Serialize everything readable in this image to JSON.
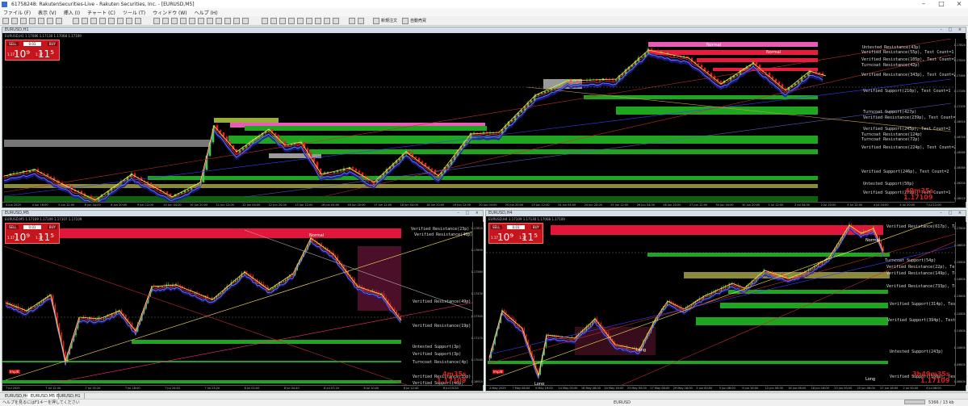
{
  "titlebar": {
    "title": "61758248: RakutenSecurities-Live - Rakuten Securities, Inc. - [EURUSD,M5]"
  },
  "menu": [
    "ファイル (F)",
    "表示 (V)",
    "挿入 (I)",
    "チャート (C)",
    "ツール (T)",
    "ウィンドウ (W)",
    "ヘルプ (H)"
  ],
  "toolbar": {
    "new_order": "新規注文",
    "auto_trade": "自動売買"
  },
  "panel": {
    "sell": "SELL",
    "buy": "BUY",
    "lot": "0.01",
    "prefix": "1.17",
    "sell_big": "10⁹",
    "buy_big": "11⁵"
  },
  "top": {
    "title": "EURUSD,H1",
    "header": "EURUSD,H1  1.17086 1.17130 1.17068 1.17109",
    "labels": [
      "Untested Resistance(43p)",
      "Verified Resistance(55p), Test Count=1",
      "Verified Resistance(105p), Test Count=1",
      "Turncoat Resistance(42p)",
      "Verified Resistance(343p), Test Count=2",
      "Verified Support(210p), Test Count=1",
      "Turncoat Support(427p)",
      "Verified Resistance(239p), Test Count=1",
      "Verified Support(245p), Test Count=2",
      "Turncoat Resistance(124p)",
      "Turncoat Resistance(72p)",
      "Verified Resistance(224p), Test Count=2",
      "Verified Support(246p), Test Count=2",
      "Untested Support(50p)",
      "Verified Support(279p), Test Count=1"
    ],
    "timer": "49m35s",
    "price": "1.17109",
    "markers": [
      "Normal",
      "Normal",
      "Normal"
    ],
    "prices": [
      "1.17820",
      "1.17640",
      "1.17460",
      "1.17280",
      "1.17100",
      "1.16920",
      "1.16740",
      "1.16560",
      "1.16380",
      "1.16200",
      "1.16020"
    ],
    "times": [
      "4 Jun 2025",
      "4 Jun 16:00",
      "5 Jun 12:00",
      "6 Jun 04:00",
      "6 Jun 20:00",
      "9 Jun 12:00",
      "10 Jun 04:00",
      "10 Jun 20:00",
      "11 Jun 12:00",
      "12 Jun 04:00",
      "12 Jun 20:00",
      "13 Jun 12:00",
      "16 Jun 04:00",
      "16 Jun 20:00",
      "17 Jun 12:00",
      "18 Jun 04:00",
      "18 Jun 20:00",
      "19 Jun 12:00",
      "20 Jun 04:00",
      "20 Jun 20:00",
      "23 Jun 12:00",
      "24 Jun 04:00",
      "24 Jun 20:00",
      "25 Jun 12:00",
      "26 Jun 04:00",
      "26 Jun 20:00",
      "27 Jun 12:00",
      "30 Jun 04:00",
      "30 Jun 20:00",
      "1 Jul 12:00",
      "2 Jul 04:00",
      "2 Jul 20:00",
      "3 Jul 12:00",
      "4 Jul 04:00",
      "4 Jul 20:00",
      "7 Jul 12:00"
    ]
  },
  "bl": {
    "title": "EURUSD,M5",
    "header": "EURUSD,M5  1.17109 1.17109 1.17107 1.17109",
    "labels": [
      "Verified Resistance(23p)",
      "Verified Resistance(40p)",
      "Verified Resistance(49p)",
      "Verified Resistance(19p)",
      "Untested Support(3p)",
      "Verified Support(3p)",
      "Turncoat Resistance(4p)",
      "Verified Resistance(35p)",
      "Verified Support(40p)"
    ],
    "timer": "4m35s",
    "price": "1.17109",
    "marker": "Normal",
    "badge": "Imp/8",
    "prices": [
      "1.17820",
      "1.17690",
      "1.17560",
      "1.17430",
      "1.17300",
      "1.17170",
      "1.17040",
      "1.16910"
    ],
    "times": [
      "7 Jul 2025",
      "7 Jul 12:40",
      "7 Jul 15:20",
      "7 Jul 18:00",
      "7 Jul 20:40",
      "7 Jul 23:20",
      "8 Jul 02:00",
      "8 Jul 04:40",
      "8 Jul 07:20",
      "8 Jul 10:00",
      "8 Jul 12:40",
      "8 Jul 15:20"
    ]
  },
  "br": {
    "title": "EURUSD,H4",
    "header": "EURUSD,H4  1.17109 1.17130 1.17068 1.17109",
    "labels": [
      "Verified Resistance(617p), Test Count=1",
      "Turncoat Support(54p)",
      "Verified Resistance(22p), Test Count=1",
      "Verified Resistance(149p), Test Count=1",
      "Verified Resistance(733p), Test Count=1",
      "Verified Support(314p), Test Count=1",
      "Verified Support(394p), Test Count=1",
      "Untested Support(243p)",
      "Verified Support(166p), Test Count=1"
    ],
    "timer": "3h49m35s",
    "price": "1.17109",
    "markers": [
      "Long",
      "Long",
      "Long",
      "Normal"
    ],
    "badge": "Imp/8",
    "prices": [
      "1.17800",
      "1.16800",
      "1.15800",
      "1.14800",
      "1.13800",
      "1.12800",
      "1.11800",
      "1.10800",
      "1.09800",
      "1.08800"
    ],
    "times": [
      "2 May 2025",
      "7 May 08:00",
      "9 May 16:00",
      "14 May 00:00",
      "16 May 08:00",
      "20 May 16:00",
      "23 May 00:00",
      "27 May 08:00",
      "29 May 16:00",
      "3 Jun 00:00",
      "5 Jun 08:00",
      "9 Jun 16:00",
      "12 Jun 00:00",
      "16 Jun 08:00",
      "18 Jun 16:00",
      "23 Jun 00:00",
      "25 Jun 08:00",
      "27 Jun 16:00",
      "2 Jul 00:00",
      "4 Jul 08:00"
    ]
  },
  "tabs": [
    "EURUSD,H4",
    "EURUSD,M5",
    "EURUSD,H1"
  ],
  "status": {
    "help": "ヘルプを見るにはF1キーを押してください",
    "profile": "EURUSD",
    "bytes": "5366 / 13 kb"
  },
  "colors": {
    "bg": "#000000",
    "support": "#3cc83c",
    "resistance": "#e8163c",
    "weak": "#8a8a3a",
    "candle_up": "#3cd23c",
    "candle_dn": "#e61e1e",
    "band": "#1c1c9e"
  }
}
